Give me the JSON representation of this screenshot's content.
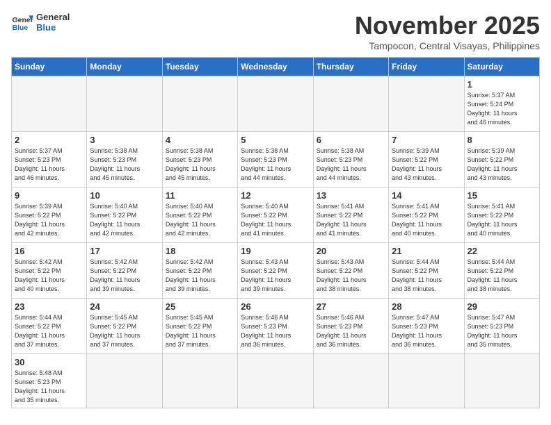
{
  "header": {
    "logo_general": "General",
    "logo_blue": "Blue",
    "month_year": "November 2025",
    "location": "Tampocon, Central Visayas, Philippines"
  },
  "days_of_week": [
    "Sunday",
    "Monday",
    "Tuesday",
    "Wednesday",
    "Thursday",
    "Friday",
    "Saturday"
  ],
  "weeks": [
    [
      {
        "day": "",
        "info": ""
      },
      {
        "day": "",
        "info": ""
      },
      {
        "day": "",
        "info": ""
      },
      {
        "day": "",
        "info": ""
      },
      {
        "day": "",
        "info": ""
      },
      {
        "day": "",
        "info": ""
      },
      {
        "day": "1",
        "info": "Sunrise: 5:37 AM\nSunset: 5:24 PM\nDaylight: 11 hours\nand 46 minutes."
      }
    ],
    [
      {
        "day": "2",
        "info": "Sunrise: 5:37 AM\nSunset: 5:23 PM\nDaylight: 11 hours\nand 46 minutes."
      },
      {
        "day": "3",
        "info": "Sunrise: 5:38 AM\nSunset: 5:23 PM\nDaylight: 11 hours\nand 45 minutes."
      },
      {
        "day": "4",
        "info": "Sunrise: 5:38 AM\nSunset: 5:23 PM\nDaylight: 11 hours\nand 45 minutes."
      },
      {
        "day": "5",
        "info": "Sunrise: 5:38 AM\nSunset: 5:23 PM\nDaylight: 11 hours\nand 44 minutes."
      },
      {
        "day": "6",
        "info": "Sunrise: 5:38 AM\nSunset: 5:23 PM\nDaylight: 11 hours\nand 44 minutes."
      },
      {
        "day": "7",
        "info": "Sunrise: 5:39 AM\nSunset: 5:22 PM\nDaylight: 11 hours\nand 43 minutes."
      },
      {
        "day": "8",
        "info": "Sunrise: 5:39 AM\nSunset: 5:22 PM\nDaylight: 11 hours\nand 43 minutes."
      }
    ],
    [
      {
        "day": "9",
        "info": "Sunrise: 5:39 AM\nSunset: 5:22 PM\nDaylight: 11 hours\nand 42 minutes."
      },
      {
        "day": "10",
        "info": "Sunrise: 5:40 AM\nSunset: 5:22 PM\nDaylight: 11 hours\nand 42 minutes."
      },
      {
        "day": "11",
        "info": "Sunrise: 5:40 AM\nSunset: 5:22 PM\nDaylight: 11 hours\nand 42 minutes."
      },
      {
        "day": "12",
        "info": "Sunrise: 5:40 AM\nSunset: 5:22 PM\nDaylight: 11 hours\nand 41 minutes."
      },
      {
        "day": "13",
        "info": "Sunrise: 5:41 AM\nSunset: 5:22 PM\nDaylight: 11 hours\nand 41 minutes."
      },
      {
        "day": "14",
        "info": "Sunrise: 5:41 AM\nSunset: 5:22 PM\nDaylight: 11 hours\nand 40 minutes."
      },
      {
        "day": "15",
        "info": "Sunrise: 5:41 AM\nSunset: 5:22 PM\nDaylight: 11 hours\nand 40 minutes."
      }
    ],
    [
      {
        "day": "16",
        "info": "Sunrise: 5:42 AM\nSunset: 5:22 PM\nDaylight: 11 hours\nand 40 minutes."
      },
      {
        "day": "17",
        "info": "Sunrise: 5:42 AM\nSunset: 5:22 PM\nDaylight: 11 hours\nand 39 minutes."
      },
      {
        "day": "18",
        "info": "Sunrise: 5:42 AM\nSunset: 5:22 PM\nDaylight: 11 hours\nand 39 minutes."
      },
      {
        "day": "19",
        "info": "Sunrise: 5:43 AM\nSunset: 5:22 PM\nDaylight: 11 hours\nand 39 minutes."
      },
      {
        "day": "20",
        "info": "Sunrise: 5:43 AM\nSunset: 5:22 PM\nDaylight: 11 hours\nand 38 minutes."
      },
      {
        "day": "21",
        "info": "Sunrise: 5:44 AM\nSunset: 5:22 PM\nDaylight: 11 hours\nand 38 minutes."
      },
      {
        "day": "22",
        "info": "Sunrise: 5:44 AM\nSunset: 5:22 PM\nDaylight: 11 hours\nand 38 minutes."
      }
    ],
    [
      {
        "day": "23",
        "info": "Sunrise: 5:44 AM\nSunset: 5:22 PM\nDaylight: 11 hours\nand 37 minutes."
      },
      {
        "day": "24",
        "info": "Sunrise: 5:45 AM\nSunset: 5:22 PM\nDaylight: 11 hours\nand 37 minutes."
      },
      {
        "day": "25",
        "info": "Sunrise: 5:45 AM\nSunset: 5:22 PM\nDaylight: 11 hours\nand 37 minutes."
      },
      {
        "day": "26",
        "info": "Sunrise: 5:46 AM\nSunset: 5:23 PM\nDaylight: 11 hours\nand 36 minutes."
      },
      {
        "day": "27",
        "info": "Sunrise: 5:46 AM\nSunset: 5:23 PM\nDaylight: 11 hours\nand 36 minutes."
      },
      {
        "day": "28",
        "info": "Sunrise: 5:47 AM\nSunset: 5:23 PM\nDaylight: 11 hours\nand 36 minutes."
      },
      {
        "day": "29",
        "info": "Sunrise: 5:47 AM\nSunset: 5:23 PM\nDaylight: 11 hours\nand 35 minutes."
      }
    ],
    [
      {
        "day": "30",
        "info": "Sunrise: 5:48 AM\nSunset: 5:23 PM\nDaylight: 11 hours\nand 35 minutes."
      },
      {
        "day": "",
        "info": ""
      },
      {
        "day": "",
        "info": ""
      },
      {
        "day": "",
        "info": ""
      },
      {
        "day": "",
        "info": ""
      },
      {
        "day": "",
        "info": ""
      },
      {
        "day": "",
        "info": ""
      }
    ]
  ]
}
